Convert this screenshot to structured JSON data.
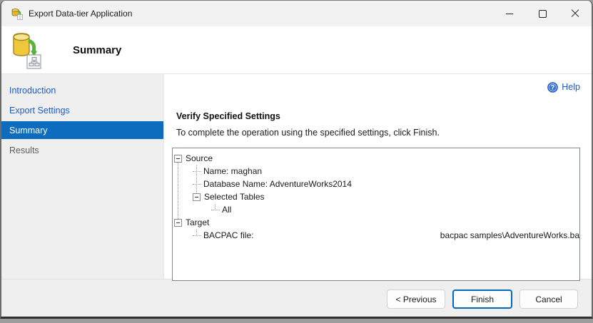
{
  "window": {
    "title": "Export Data-tier Application"
  },
  "icons": {
    "app_icon": "database-export-icon",
    "header_icon": "database-export-summary-icon",
    "help_icon": "help-circle-icon",
    "minimize_icon": "minimize-icon",
    "maximize_icon": "maximize-icon",
    "close_icon": "close-icon"
  },
  "colors": {
    "sidebar_selected_bg": "#0d6cbe",
    "link_blue": "#1c5bc8",
    "finish_border": "#0067c0",
    "sidebar_bg": "#efefef",
    "footer_bg": "#efefef",
    "tree_border": "#828790"
  },
  "header": {
    "title": "Summary"
  },
  "sidebar": {
    "items": [
      {
        "label": "Introduction",
        "state": "link"
      },
      {
        "label": "Export Settings",
        "state": "link"
      },
      {
        "label": "Summary",
        "state": "selected"
      },
      {
        "label": "Results",
        "state": "disabled"
      }
    ]
  },
  "main": {
    "help_label": "Help",
    "section_title": "Verify Specified Settings",
    "instruction": "To complete the operation using the specified settings, click Finish.",
    "tree": [
      {
        "label": "Source",
        "level": 0,
        "expanded": true
      },
      {
        "label": "Name: maghan",
        "level": 1
      },
      {
        "label": "Database Name: AdventureWorks2014",
        "level": 1
      },
      {
        "label": "Selected Tables",
        "level": 1,
        "expanded": true
      },
      {
        "label": "All",
        "level": 2
      },
      {
        "label": "Target",
        "level": 0,
        "expanded": true
      },
      {
        "label": "BACPAC file:",
        "level": 1,
        "value": "bacpac samples\\AdventureWorks.ba"
      }
    ]
  },
  "footer": {
    "buttons": [
      {
        "label": "< Previous",
        "default": false
      },
      {
        "label": "Finish",
        "default": true
      },
      {
        "label": "Cancel",
        "default": false
      }
    ]
  }
}
